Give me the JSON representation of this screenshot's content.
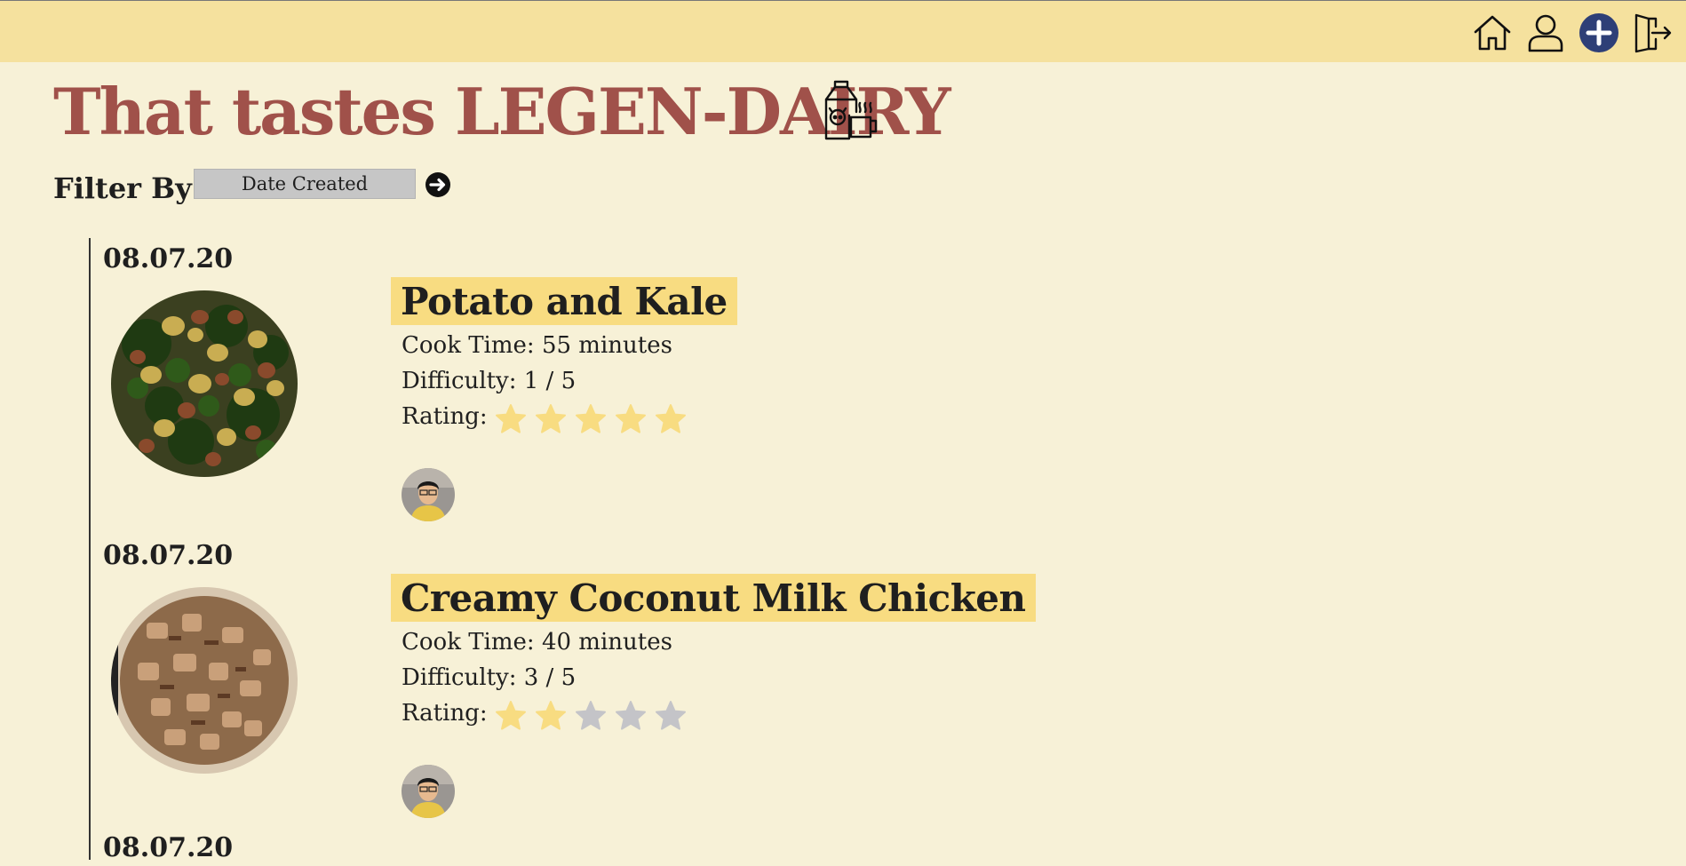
{
  "header": {
    "nav": [
      {
        "name": "home-icon"
      },
      {
        "name": "user-icon"
      },
      {
        "name": "add-icon"
      },
      {
        "name": "logout-icon"
      }
    ]
  },
  "page": {
    "title": "That tastes LEGEN-DAIRY",
    "category_icon": "milk-carton-mug-icon"
  },
  "filter": {
    "label": "Filter By",
    "selected": "Date Created",
    "go_icon": "arrow-right-circle-icon"
  },
  "colors": {
    "topbar": "#f5e19e",
    "background": "#f7f1d7",
    "title": "#a0514a",
    "highlight": "#f8dc81",
    "star_on": "#f8dc81",
    "star_off": "#c4c4c8",
    "add_button": "#2e3f77"
  },
  "recipes": [
    {
      "date": "08.07.20",
      "title": "Potato and Kale",
      "cook_time_label": "Cook Time: 55 minutes",
      "difficulty_label": "Difficulty: 1 / 5",
      "rating_label": "Rating:",
      "rating": 5,
      "rating_max": 5
    },
    {
      "date": "08.07.20",
      "title": "Creamy Coconut Milk Chicken",
      "cook_time_label": "Cook Time: 40 minutes",
      "difficulty_label": "Difficulty: 3 / 5",
      "rating_label": "Rating:",
      "rating": 2,
      "rating_max": 5
    }
  ],
  "partial_next_date": "08.07.20"
}
